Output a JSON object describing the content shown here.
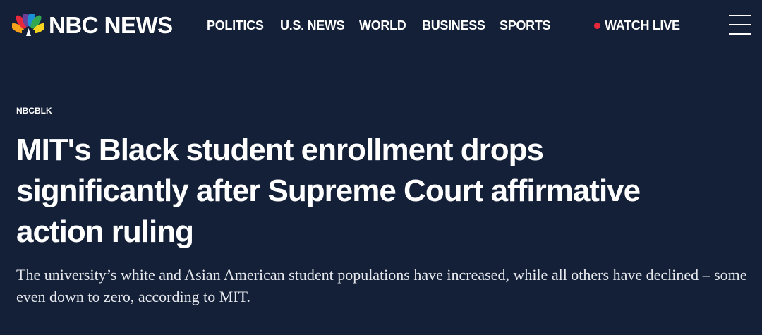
{
  "header": {
    "logo_text": "NBC NEWS",
    "nav": [
      "POLITICS",
      "U.S. NEWS",
      "WORLD",
      "BUSINESS",
      "SPORTS"
    ],
    "watch_live": "WATCH LIVE",
    "live_dot_color": "#e8283b",
    "menu_icon": "hamburger-menu-icon"
  },
  "article": {
    "eyebrow": "NBCBLK",
    "headline": "MIT's Black student enrollment drops significantly after Supreme Court affirmative action ruling",
    "dek": "The university’s white and Asian American student populations have increased, while all others have declined – some even down to zero, according to MIT."
  },
  "colors": {
    "background": "#132037",
    "text": "#ffffff"
  }
}
